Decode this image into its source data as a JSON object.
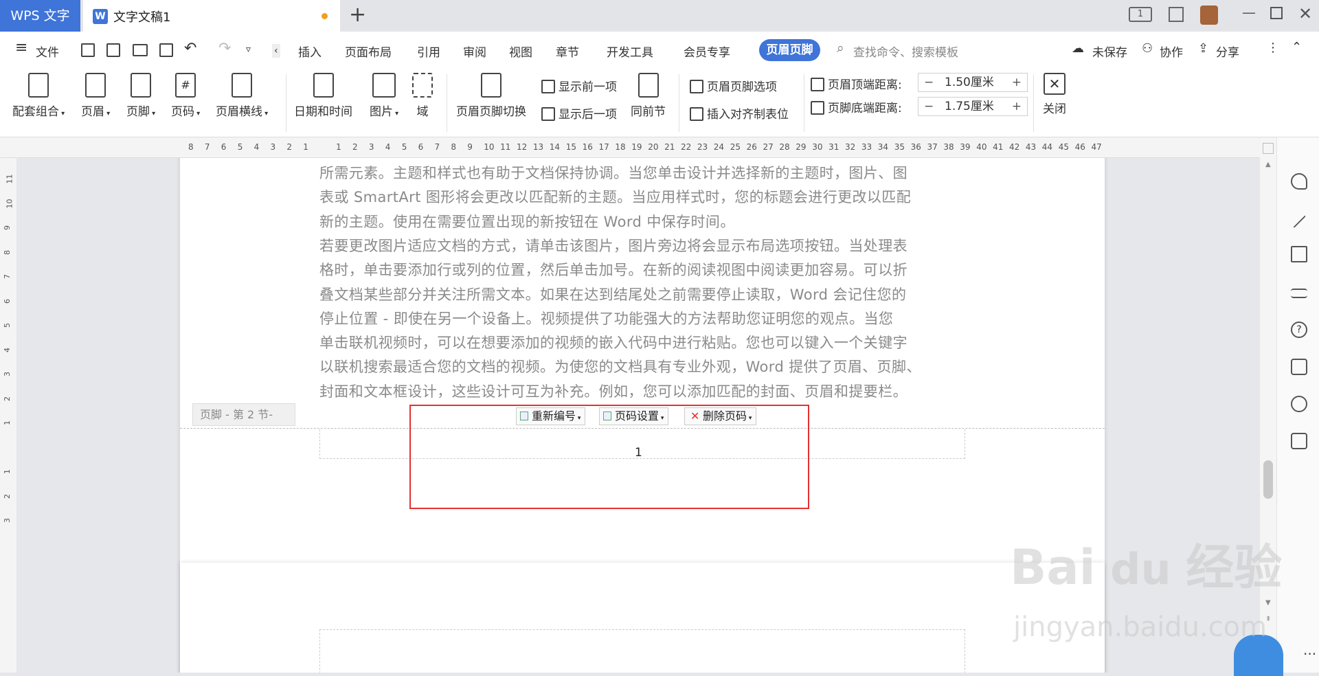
{
  "titlebar": {
    "app_tab": "WPS 文字",
    "doc_tab": "文字文稿1",
    "doc_icon": "W",
    "new_tab": "+",
    "page_indicator": "1"
  },
  "menu": {
    "file": "文件",
    "items": [
      "插入",
      "页面布局",
      "引用",
      "审阅",
      "视图",
      "章节",
      "开发工具",
      "会员专享"
    ],
    "active_tab": "页眉页脚",
    "search_placeholder": "查找命令、搜索模板",
    "unsaved": "未保存",
    "collaborate": "协作",
    "share": "分享"
  },
  "ribbon": {
    "combo": "配套组合",
    "header": "页眉",
    "footer": "页脚",
    "page_number": "页码",
    "header_line": "页眉横线",
    "datetime": "日期和时间",
    "picture": "图片",
    "field": "域",
    "switch": "页眉页脚切换",
    "show_prev": "显示前一项",
    "show_next": "显示后一项",
    "same_as_prev": "同前节",
    "hf_options": "页眉页脚选项",
    "insert_tab": "插入对齐制表位",
    "top_dist_label": "页眉顶端距离:",
    "top_dist_value": "1.50厘米",
    "bottom_dist_label": "页脚底端距离:",
    "bottom_dist_value": "1.75厘米",
    "close": "关闭"
  },
  "ruler_numbers": [
    "8",
    "7",
    "6",
    "5",
    "4",
    "3",
    "2",
    "1",
    "",
    "1",
    "2",
    "3",
    "4",
    "5",
    "6",
    "7",
    "8",
    "9",
    "10",
    "11",
    "12",
    "13",
    "14",
    "15",
    "16",
    "17",
    "18",
    "19",
    "20",
    "21",
    "22",
    "23",
    "24",
    "25",
    "26",
    "27",
    "28",
    "29",
    "30",
    "31",
    "32",
    "33",
    "34",
    "35",
    "36",
    "37",
    "38",
    "39",
    "40",
    "41",
    "42",
    "43",
    "44",
    "45",
    "46",
    "47"
  ],
  "vruler_numbers": [
    "11",
    "10",
    "9",
    "8",
    "7",
    "6",
    "5",
    "4",
    "3",
    "2",
    "1",
    "",
    "1",
    "2",
    "3"
  ],
  "document": {
    "lines": [
      "所需元素。主题和样式也有助于文档保持协调。当您单击设计并选择新的主题时，图片、图",
      "表或 SmartArt 图形将会更改以匹配新的主题。当应用样式时，您的标题会进行更改以匹配",
      "新的主题。使用在需要位置出现的新按钮在 Word 中保存时间。",
      "若要更改图片适应文档的方式，请单击该图片，图片旁边将会显示布局选项按钮。当处理表",
      "格时，单击要添加行或列的位置，然后单击加号。在新的阅读视图中阅读更加容易。可以折",
      "叠文档某些部分并关注所需文本。如果在达到结尾处之前需要停止读取，Word 会记住您的",
      "停止位置 - 即使在另一个设备上。视频提供了功能强大的方法帮助您证明您的观点。当您",
      "单击联机视频时，可以在想要添加的视频的嵌入代码中进行粘贴。您也可以键入一个关键字",
      "以联机搜索最适合您的文档的视频。为使您的文档具有专业外观，Word 提供了页眉、页脚、",
      "封面和文本框设计，这些设计可互为补充。例如，您可以添加匹配的封面、页眉和提要栏。"
    ]
  },
  "footer": {
    "label": "页脚 - 第 2 节-",
    "renumber": "重新编号",
    "page_settings": "页码设置",
    "delete_page_number": "删除页码",
    "page_number": "1"
  },
  "watermark": {
    "brand": "Bai",
    "brand_suffix": "经验",
    "url": "jingyan.baidu.com"
  },
  "colors": {
    "accent": "#3f74d8",
    "highlight_box": "#e53030"
  }
}
